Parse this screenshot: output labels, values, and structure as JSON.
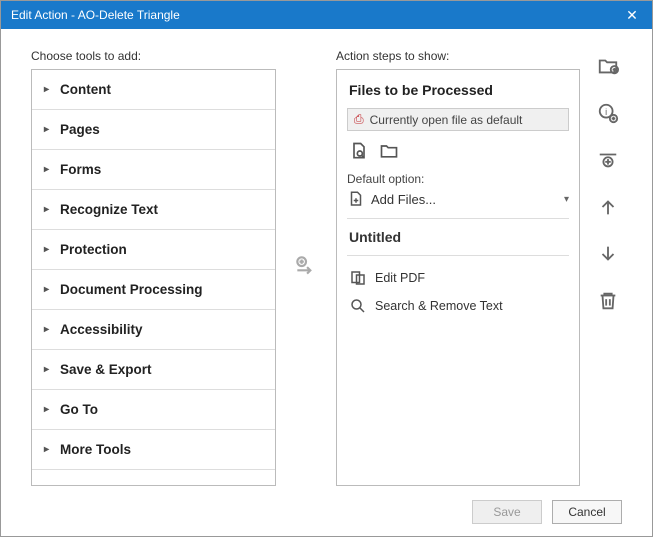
{
  "window": {
    "title": "Edit Action - AO-Delete Triangle"
  },
  "left": {
    "label": "Choose tools to add:",
    "categories": [
      "Content",
      "Pages",
      "Forms",
      "Recognize Text",
      "Protection",
      "Document Processing",
      "Accessibility",
      "Save & Export",
      "Go To",
      "More Tools"
    ]
  },
  "right": {
    "label": "Action steps to show:",
    "panel1_title": "Files to be Processed",
    "default_file": "Currently open file as default",
    "default_option_label": "Default option:",
    "add_files": "Add Files...",
    "panel2_title": "Untitled",
    "steps": [
      "Edit PDF",
      "Search & Remove Text"
    ]
  },
  "footer": {
    "save": "Save",
    "cancel": "Cancel"
  }
}
